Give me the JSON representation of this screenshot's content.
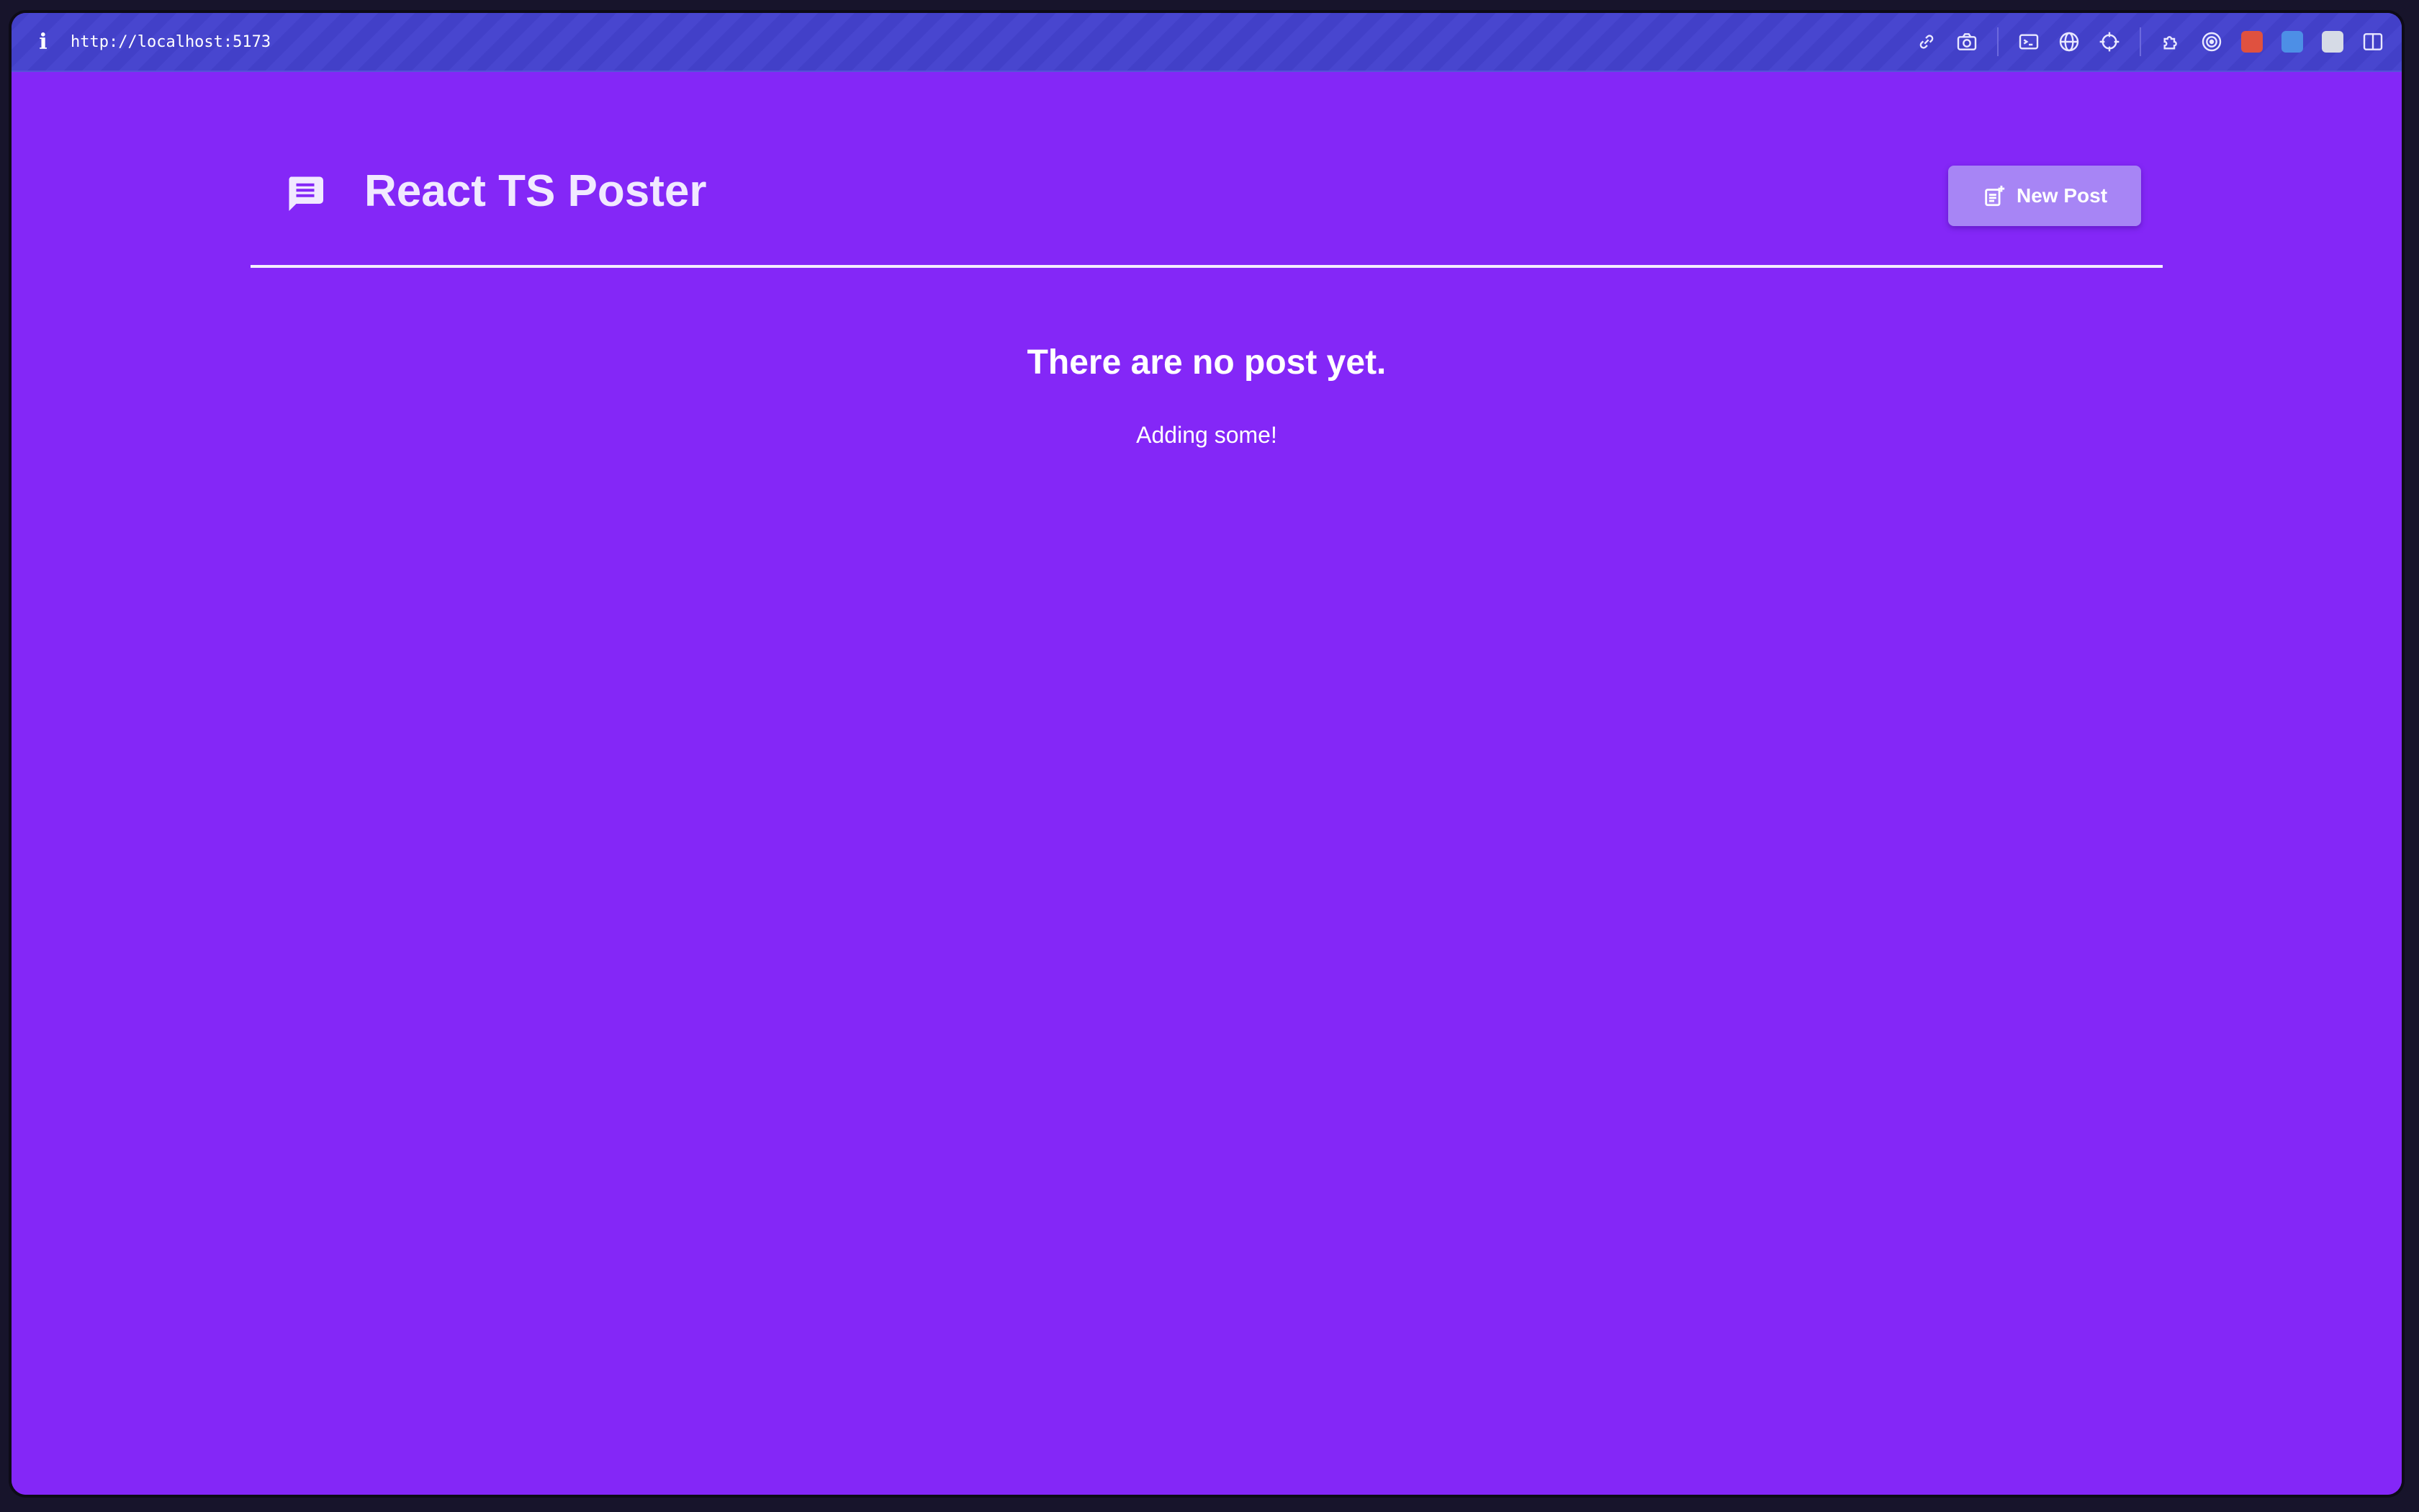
{
  "browser": {
    "info_icon": "info-icon",
    "url": "http://localhost:5173",
    "tools": [
      "link-icon",
      "camera-icon",
      "terminal-icon",
      "globe-icon",
      "crosshair-icon",
      "puzzle-icon",
      "target-icon",
      "extension-icon",
      "translate-icon",
      "extension-icon",
      "split-view-icon"
    ]
  },
  "header": {
    "logo_icon": "message-icon",
    "title": "React TS Poster",
    "new_post_label": "New Post"
  },
  "empty_state": {
    "title": "There are no post yet.",
    "subtitle": "Adding some!"
  },
  "colors": {
    "background": "#8427f7",
    "urlbar": "#4240c8",
    "button": "#a785f5",
    "divider": "#f3eefe"
  }
}
